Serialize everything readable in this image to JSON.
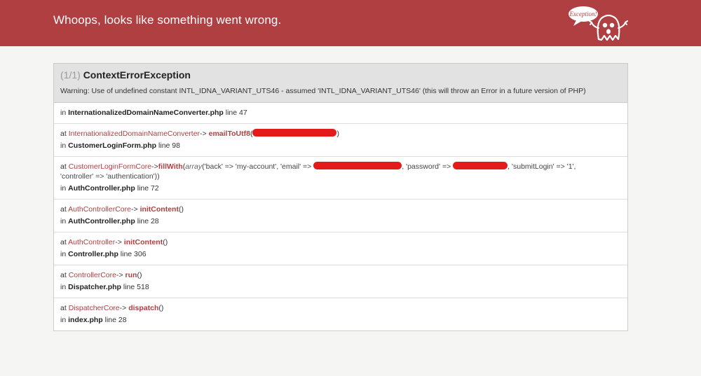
{
  "header": {
    "title": "Whoops, looks like something went wrong.",
    "logo_text": "Exception!",
    "bg_color": "#b03f41"
  },
  "exception": {
    "count": "(1/1)",
    "name": "ContextErrorException",
    "message": "Warning: Use of undefined constant INTL_IDNA_VARIANT_UTS46 - assumed 'INTL_IDNA_VARIANT_UTS46' (this will throw an Error in a future version of PHP)"
  },
  "trace": [
    {
      "in_label": "in",
      "file": "InternationalizedDomainNameConverter.php",
      "line_label": "line 47"
    },
    {
      "at_label": "at",
      "class": "InternationalizedDomainNameConverter",
      "arrow": "->",
      "method": "emailToUtf8",
      "open": "(",
      "close": ")",
      "in_label": "in",
      "file": "CustomerLoginForm.php",
      "line_label": "line 98"
    },
    {
      "at_label": "at",
      "class": "CustomerLoginFormCore",
      "arrow": "->",
      "method": "fillWith",
      "open": "(",
      "array_kw": "array",
      "args_a": "('back' => 'my-account', 'email' =>",
      "args_b": ", 'password' =>",
      "args_c": ", 'submitLogin' => '1',",
      "args_d": "'controller' => 'authentication'))",
      "in_label": "in",
      "file": "AuthController.php",
      "line_label": "line 72"
    },
    {
      "at_label": "at",
      "class": "AuthControllerCore",
      "arrow": "->",
      "method": "initContent",
      "parens": "()",
      "in_label": "in",
      "file": "AuthController.php",
      "line_label": "line 28"
    },
    {
      "at_label": "at",
      "class": "AuthController",
      "arrow": "->",
      "method": "initContent",
      "parens": "()",
      "in_label": "in",
      "file": "Controller.php",
      "line_label": "line 306"
    },
    {
      "at_label": "at",
      "class": "ControllerCore",
      "arrow": "->",
      "method": "run",
      "parens": "()",
      "in_label": "in",
      "file": "Dispatcher.php",
      "line_label": "line 518"
    },
    {
      "at_label": "at",
      "class": "DispatcherCore",
      "arrow": "->",
      "method": "dispatch",
      "parens": "()",
      "in_label": "in",
      "file": "index.php",
      "line_label": "line 28"
    }
  ]
}
